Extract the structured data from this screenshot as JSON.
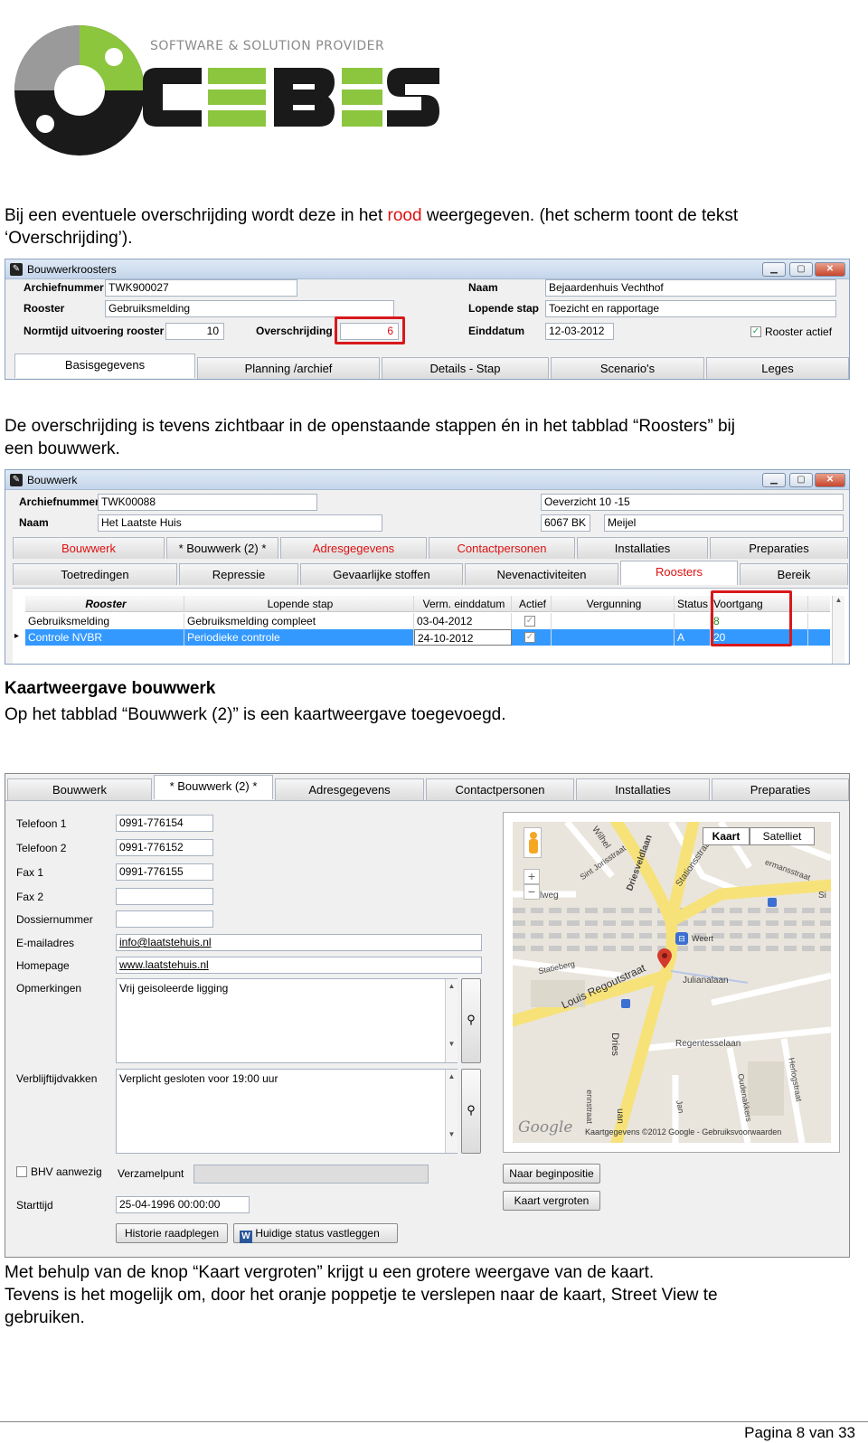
{
  "logo": {
    "tagline": "SOFTWARE & SOLUTION PROVIDER",
    "brand": "CEBES",
    "colors": {
      "dark": "#1a1a1a",
      "green": "#8cc63f",
      "gray": "#999999"
    }
  },
  "p1": {
    "before": "Bij een eventuele overschrijding wordt deze in het ",
    "red": "rood",
    "after": " weergegeven. (het scherm toont de tekst",
    "line2": "‘Overschrijding’)."
  },
  "win1": {
    "title": "Bouwwerkroosters",
    "labels": {
      "archief": "Archiefnummer",
      "rooster": "Rooster",
      "normtijd": "Normtijd uitvoering rooster",
      "overschrijding": "Overschrijding",
      "naam": "Naam",
      "lopende": "Lopende stap",
      "einddatum": "Einddatum",
      "actief": "Rooster actief"
    },
    "values": {
      "archief": "TWK900027",
      "rooster": "Gebruiksmelding",
      "normtijd": "10",
      "overschrijding": "6",
      "naam": "Bejaardenhuis Vechthof",
      "lopende": "Toezicht en rapportage",
      "einddatum": "12-03-2012"
    },
    "tabs": [
      "Basisgegevens",
      "Planning /archief",
      "Details - Stap",
      "Scenario's",
      "Leges"
    ]
  },
  "p2": {
    "line1": "De overschrijding is tevens zichtbaar in de openstaande stappen én in het tabblad “Roosters” bij",
    "line2": "een bouwwerk."
  },
  "win2": {
    "title": "Bouwwerk",
    "labels": {
      "archief": "Archiefnummer",
      "naam": "Naam"
    },
    "values": {
      "archief": "TWK00088",
      "naam": "Het Laatste Huis",
      "adres": "Oeverzicht 10 -15",
      "postcode": "6067 BK",
      "plaats": "Meijel"
    },
    "tabs1": [
      "Bouwwerk",
      "* Bouwwerk (2) *",
      "Adresgegevens",
      "Contactpersonen",
      "Installaties",
      "Preparaties"
    ],
    "tabs2": [
      "Toetredingen",
      "Repressie",
      "Gevaarlijke stoffen",
      "Nevenactiviteiten",
      "Roosters",
      "Bereik"
    ],
    "columns": [
      "Rooster",
      "Lopende stap",
      "Verm. einddatum",
      "Actief",
      "Vergunning",
      "Status",
      "Voortgang"
    ],
    "rows": [
      {
        "rooster": "Gebruiksmelding",
        "stap": "Gebruiksmelding compleet",
        "datum": "03-04-2012",
        "status": "",
        "voortgang": "8"
      },
      {
        "rooster": "Controle NVBR",
        "stap": "Periodieke controle",
        "datum": "24-10-2012",
        "status": "A",
        "voortgang": "20"
      }
    ]
  },
  "section": {
    "heading": "Kaartweergave bouwwerk",
    "text": "Op het tabblad “Bouwwerk (2)” is een kaartweergave toegevoegd."
  },
  "win3": {
    "tabs": [
      "Bouwwerk",
      "* Bouwwerk (2) *",
      "Adresgegevens",
      "Contactpersonen",
      "Installaties",
      "Preparaties"
    ],
    "labels": {
      "tel1": "Telefoon 1",
      "tel2": "Telefoon 2",
      "fax1": "Fax 1",
      "fax2": "Fax 2",
      "dossier": "Dossiernummer",
      "email": "E-mailadres",
      "homepage": "Homepage",
      "opm": "Opmerkingen",
      "verblijf": "Verblijftijdvakken",
      "bhv": "BHV aanwezig",
      "verzamel": "Verzamelpunt",
      "starttijd": "Starttijd"
    },
    "values": {
      "tel1": "0991-776154",
      "tel2": "0991-776152",
      "fax1": "0991-776155",
      "fax2": "",
      "dossier": "",
      "email": "info@laatstehuis.nl",
      "homepage": "www.laatstehuis.nl",
      "opm": "Vrij geisoleerde ligging",
      "verblijf": "Verplicht gesloten voor 19:00 uur",
      "verzamel": "",
      "starttijd": "25-04-1996 00:00:00"
    },
    "buttons": {
      "historie": "Historie raadplegen",
      "status": "Huidige status vastleggen",
      "begin": "Naar beginpositie",
      "vergroten": "Kaart vergroten"
    },
    "map": {
      "type_kaart": "Kaart",
      "type_satelliet": "Satelliet",
      "streets": [
        "Wilhel",
        "Sint Jorisstraat",
        "Driesveldlaan",
        "Stationsstraat",
        "lweg",
        "Statieberg",
        "Louis Regoutstraat",
        "Julianalaan",
        "Dries",
        "Regentesselaan",
        "Oudenakkers",
        "Herlogstraat",
        "Jan",
        "uan",
        "ennstraat",
        "ermansstraat",
        "Si",
        "Weert"
      ],
      "google": "Google",
      "attribution": "Kaartgegevens ©2012 Google - Gebruiksvoorwaarden"
    }
  },
  "p3": {
    "line1": "Met behulp van de knop “Kaart vergroten” krijgt u een grotere weergave van de kaart.",
    "line2": "Tevens is het mogelijk om, door het oranje poppetje te verslepen naar de kaart, Street View te",
    "line3": "gebruiken."
  },
  "footer": {
    "page": "Pagina 8 van 33"
  }
}
